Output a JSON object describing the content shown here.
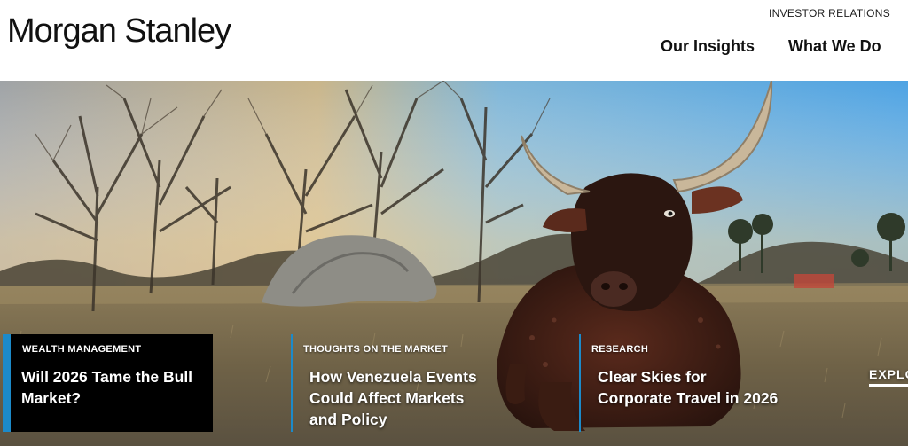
{
  "header": {
    "logo": "Morgan Stanley",
    "utility_link": "INVESTOR RELATIONS",
    "nav": [
      {
        "label": "Our Insights"
      },
      {
        "label": "What We Do"
      }
    ]
  },
  "hero": {
    "cards": [
      {
        "category": "WEALTH MANAGEMENT",
        "title": "Will 2026 Tame the Bull Market?"
      },
      {
        "category": "THOUGHTS ON THE MARKET",
        "title": "How Venezuela Events Could Affect Markets and Policy"
      },
      {
        "category": "RESEARCH",
        "title": "Clear Skies for Corporate Travel in 2026"
      }
    ],
    "explore_label": "EXPLO"
  },
  "colors": {
    "accent": "#1c8ac9",
    "card_bg": "#000000",
    "text_dark": "#111111",
    "white": "#ffffff"
  },
  "icons": []
}
